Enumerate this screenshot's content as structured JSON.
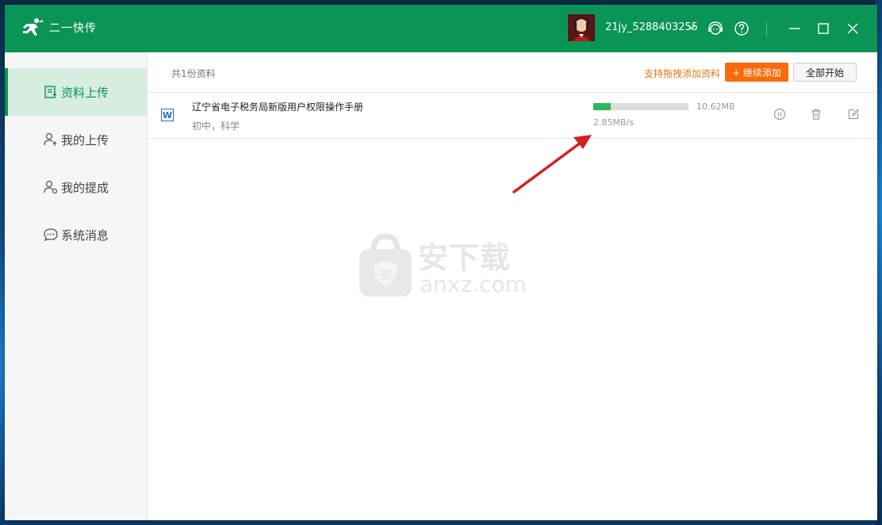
{
  "app": {
    "name": "二一快传",
    "username": "21jy_5288403255"
  },
  "sidebar": {
    "items": [
      {
        "label": "资料上传",
        "icon": "document-upload-icon",
        "active": true
      },
      {
        "label": "我的上传",
        "icon": "user-upload-icon",
        "active": false
      },
      {
        "label": "我的提成",
        "icon": "user-commission-icon",
        "active": false
      },
      {
        "label": "系统消息",
        "icon": "chat-bubble-icon",
        "active": false
      }
    ]
  },
  "list": {
    "count_text": "共1份资料",
    "drag_hint": "支持拖拽添加资料",
    "add_button": "+ 继续添加",
    "start_all_button": "全部开始"
  },
  "files": [
    {
      "name": "辽宁省电子税务局新版用户权限操作手册",
      "meta": "初中，科学",
      "size": "10.62MB",
      "speed": "2.85MB/s",
      "progress": 0.18,
      "type_icon": "word-file-icon"
    }
  ],
  "watermark": {
    "text_cn": "安下载",
    "text_en": "anxz.com"
  },
  "colors": {
    "titlebar": "#0a9456",
    "accent_green": "#0a9456",
    "add_button": "#fa6a0a",
    "drag_hint": "#e07a14",
    "progress": "#2db85c",
    "annotation_arrow": "#d42020"
  }
}
